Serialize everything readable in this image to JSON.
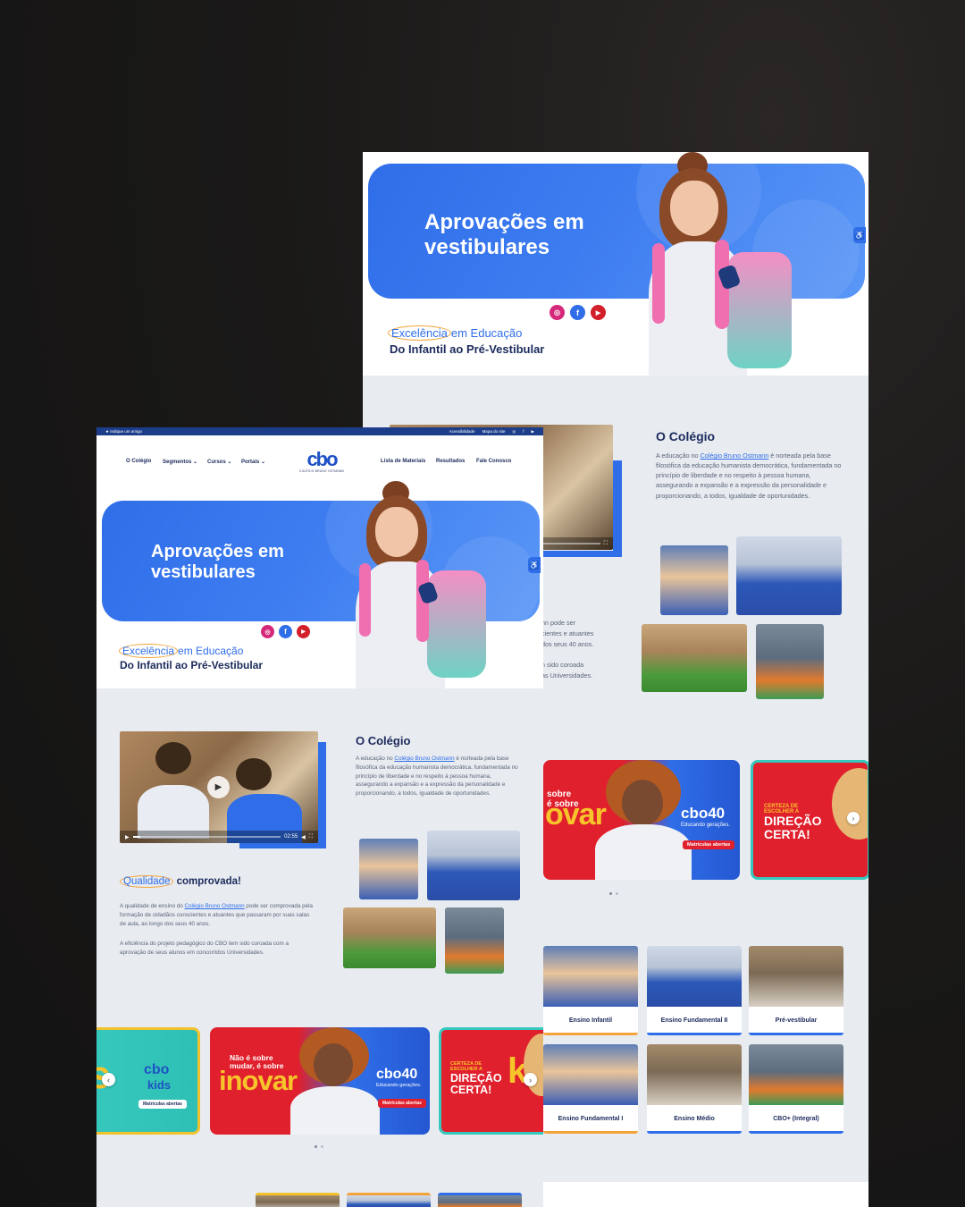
{
  "colors": {
    "background": "#1a1918",
    "brand_blue": "#2f6ee8",
    "navy": "#1b2a5b",
    "red": "#e0202c",
    "teal": "#37c8bd",
    "yellow": "#f7c52b",
    "orange": "#f2a43a",
    "page_gray": "#e8ecf1"
  },
  "back": {
    "hero": {
      "title_line1": "Aprovações em",
      "title_line2": "vestibulares",
      "tagline_highlight": "Excelência",
      "tagline_rest": "em Educação",
      "tagline_line2": "Do Infantil ao Pré-Vestibular",
      "social": [
        "instagram-icon",
        "facebook-icon",
        "youtube-icon"
      ]
    },
    "colegio": {
      "title": "O Colégio",
      "para_pre": "A educação no ",
      "para_link": "Colégio Bruno Ostmann",
      "para_post": " é norteada pela base filosófica da educação humanista democrática, fundamentada no princípio de liberdade e no respeito à pessoa humana, assegurando a expansão e a expressão da personalidade e proporcionando, a todos, igualdade de oportunidades."
    },
    "qualidade_partial": {
      "line1": "nn pode ser",
      "line2": "cientes e atuantes",
      "line3": "dos seus 40 anos.",
      "line4": "n sido coroada",
      "line5": "as Universidades."
    },
    "banners": {
      "inovar_small": "sobre\né sobre",
      "inovar_big": "ovar",
      "cbo40": "cbo40",
      "cbo40_sub": "Educando gerações.",
      "pill": "Matrículas abertas",
      "direcao_small": "CERTEZA DE\nESCOLHER A",
      "direcao_big": "DIREÇÃO\nCERTA!"
    },
    "segments": [
      {
        "label": "Ensino Infantil"
      },
      {
        "label": "Ensino Fundamental II"
      },
      {
        "label": "Pré-vestibular"
      },
      {
        "label": "Ensino Fundamental I"
      },
      {
        "label": "Ensino Médio"
      },
      {
        "label": "CBO+ (Integral)"
      }
    ]
  },
  "front": {
    "topbar": {
      "left": "★ Indique um amigo",
      "accessibility": "Acessibilidade",
      "sitemap": "Mapa do site"
    },
    "nav": {
      "o_colegio": "O Colégio",
      "segmentos": "Segmentos ⌄",
      "cursos": "Cursos ⌄",
      "portais": "Portais ⌄",
      "lista": "Lista de Materiais",
      "resultados": "Resultados",
      "fale": "Fale Conosco",
      "logo": "cbo",
      "logo_tag": "COLÉGIO BRUNO OSTMANN"
    },
    "hero": {
      "title_line1": "Aprovações em",
      "title_line2": "vestibulares",
      "tagline_highlight": "Excelência",
      "tagline_rest": "em Educação",
      "tagline_line2": "Do Infantil ao Pré-Vestibular"
    },
    "video": {
      "time": "02:55"
    },
    "colegio": {
      "title": "O Colégio",
      "para_pre": "A educação no ",
      "para_link": "Colégio Bruno Ostmann",
      "para_post": " é norteada pela base filosófica da educação humanista democrática, fundamentada no princípio de liberdade e no respeito à pessoa humana, assegurando a expansão e a expressão da personalidade e proporcionando, a todos, igualdade de oportunidades."
    },
    "qualidade": {
      "title_highlight": "Qualidade",
      "title_rest": " comprovada!",
      "p1_pre": "A qualidade de ensino do ",
      "p1_link": "Colégio Bruno Ostmann",
      "p1_post": " pode ser comprovada pela formação de cidadãos conscientes e atuantes que passaram por suas salas de aula, ao longo dos seus 40 anos.",
      "p2": "A eficiência do projeto pedagógico do CBO tem sido coroada com a aprovação de seus alunos em concorridos Universidades."
    },
    "banners": {
      "kids_big": "s",
      "kids_logo1": "cbo",
      "kids_logo2": "kids",
      "kids_pill": "Matrículas abertas",
      "inovar_small": "Não é sobre\nmudar, é sobre",
      "inovar_big": "inovar",
      "cbo40": "cbo40",
      "cbo40_sub": "Educando gerações.",
      "pill": "Matrículas abertas",
      "direcao_small": "CERTEZA DE\nESCOLHER A",
      "direcao_big": "DIREÇÃO\nCERTA!",
      "direcao_k": "k"
    }
  }
}
